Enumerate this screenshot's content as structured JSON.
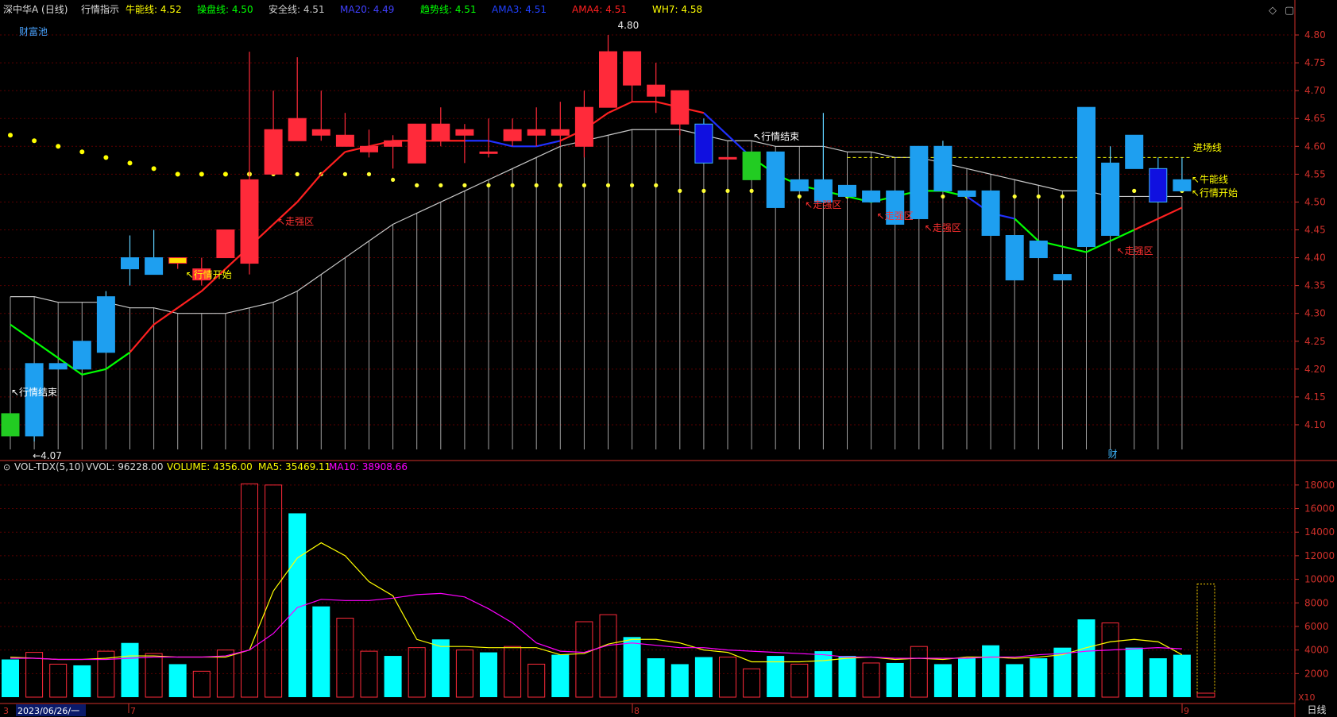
{
  "header": {
    "stock_label": "深中华A (日线)",
    "indicator_name": "行情指示",
    "params": [
      {
        "label": "牛能线:",
        "value": "4.52",
        "color": "#ffff00"
      },
      {
        "label": "操盘线:",
        "value": "4.50",
        "color": "#00ff00"
      },
      {
        "label": "安全线:",
        "value": "4.51",
        "color": "#c8c8c8"
      },
      {
        "label": "MA20:",
        "value": "4.49",
        "color": "#4040ff"
      },
      {
        "label": "趋势线:",
        "value": "4.51",
        "color": "#00ff00"
      },
      {
        "label": "AMA3:",
        "value": "4.51",
        "color": "#2040ff"
      },
      {
        "label": "AMA4:",
        "value": "4.51",
        "color": "#ff2020"
      },
      {
        "label": "WH7:",
        "value": "4.58",
        "color": "#ffff00"
      }
    ],
    "caifuchi": "财富池"
  },
  "volume_header": {
    "name": "VOL-TDX(5,10)",
    "vvol": "VVOL: 96228.00",
    "volume": "VOLUME: 4356.00",
    "ma5": "MA5: 35469.11",
    "ma10": "MA10: 38908.66"
  },
  "price_axis_ticks": [
    "4.80",
    "4.75",
    "4.70",
    "4.65",
    "4.60",
    "4.55",
    "4.50",
    "4.45",
    "4.40",
    "4.35",
    "4.30",
    "4.25",
    "4.20",
    "4.15",
    "4.10"
  ],
  "volume_axis_ticks": [
    "18000",
    "16000",
    "14000",
    "12000",
    "10000",
    "8000",
    "6000",
    "4000",
    "2000"
  ],
  "volume_unit": "X10",
  "date_axis": {
    "start": "2023/06/26/一",
    "marks": [
      "7",
      "8",
      "9"
    ],
    "first_mark": "3"
  },
  "period_tab": "日线",
  "annotations": {
    "high": "4.80",
    "low": "4.07",
    "market_end": "行情结束",
    "market_start": "行情开始",
    "strong_zone": "走强区",
    "entry_line": "进场线",
    "bull_line": "牛能线",
    "cai": "财"
  },
  "colors": {
    "up": "#ff2a3a",
    "down": "#1e9ff0",
    "cyan_vol": "#00ffff",
    "ma5_line": "#ffff00",
    "ma10_line": "#ff00ff",
    "safety_line": "#c8c8c8",
    "axis": "#d0302a",
    "grid": "#5a0000"
  },
  "chart_data": [
    {
      "type": "candlestick",
      "title": "深中华A (日线)",
      "ylim": [
        4.07,
        4.82
      ],
      "candles": [
        {
          "o": 4.08,
          "h": 4.12,
          "l": 4.08,
          "c": 4.12,
          "kind": "green"
        },
        {
          "o": 4.21,
          "h": 4.21,
          "l": 4.07,
          "c": 4.08,
          "kind": "down"
        },
        {
          "o": 4.21,
          "h": 4.21,
          "l": 4.2,
          "c": 4.2,
          "kind": "down"
        },
        {
          "o": 4.25,
          "h": 4.25,
          "l": 4.2,
          "c": 4.2,
          "kind": "down"
        },
        {
          "o": 4.33,
          "h": 4.34,
          "l": 4.23,
          "c": 4.23,
          "kind": "down"
        },
        {
          "o": 4.4,
          "h": 4.44,
          "l": 4.35,
          "c": 4.38,
          "kind": "down"
        },
        {
          "o": 4.4,
          "h": 4.45,
          "l": 4.37,
          "c": 4.37,
          "kind": "down"
        },
        {
          "o": 4.39,
          "h": 4.4,
          "l": 4.38,
          "c": 4.4,
          "kind": "yellow"
        },
        {
          "o": 4.36,
          "h": 4.4,
          "l": 4.35,
          "c": 4.38,
          "kind": "up"
        },
        {
          "o": 4.4,
          "h": 4.45,
          "l": 4.4,
          "c": 4.45,
          "kind": "up"
        },
        {
          "o": 4.39,
          "h": 4.77,
          "l": 4.37,
          "c": 4.54,
          "kind": "up"
        },
        {
          "o": 4.55,
          "h": 4.7,
          "l": 4.55,
          "c": 4.63,
          "kind": "up"
        },
        {
          "o": 4.61,
          "h": 4.76,
          "l": 4.61,
          "c": 4.65,
          "kind": "up"
        },
        {
          "o": 4.62,
          "h": 4.7,
          "l": 4.61,
          "c": 4.63,
          "kind": "up"
        },
        {
          "o": 4.6,
          "h": 4.66,
          "l": 4.6,
          "c": 4.62,
          "kind": "up"
        },
        {
          "o": 4.59,
          "h": 4.63,
          "l": 4.58,
          "c": 4.6,
          "kind": "up"
        },
        {
          "o": 4.6,
          "h": 4.62,
          "l": 4.56,
          "c": 4.61,
          "kind": "up"
        },
        {
          "o": 4.57,
          "h": 4.64,
          "l": 4.57,
          "c": 4.64,
          "kind": "up"
        },
        {
          "o": 4.61,
          "h": 4.67,
          "l": 4.6,
          "c": 4.64,
          "kind": "up"
        },
        {
          "o": 4.62,
          "h": 4.64,
          "l": 4.57,
          "c": 4.63,
          "kind": "up"
        },
        {
          "o": 4.59,
          "h": 4.65,
          "l": 4.58,
          "c": 4.59,
          "kind": "up"
        },
        {
          "o": 4.61,
          "h": 4.65,
          "l": 4.6,
          "c": 4.63,
          "kind": "up"
        },
        {
          "o": 4.62,
          "h": 4.67,
          "l": 4.6,
          "c": 4.63,
          "kind": "up"
        },
        {
          "o": 4.62,
          "h": 4.68,
          "l": 4.6,
          "c": 4.63,
          "kind": "up"
        },
        {
          "o": 4.6,
          "h": 4.7,
          "l": 4.58,
          "c": 4.67,
          "kind": "up"
        },
        {
          "o": 4.67,
          "h": 4.8,
          "l": 4.67,
          "c": 4.77,
          "kind": "up"
        },
        {
          "o": 4.71,
          "h": 4.77,
          "l": 4.68,
          "c": 4.77,
          "kind": "up"
        },
        {
          "o": 4.69,
          "h": 4.75,
          "l": 4.66,
          "c": 4.71,
          "kind": "up"
        },
        {
          "o": 4.64,
          "h": 4.7,
          "l": 4.62,
          "c": 4.7,
          "kind": "up"
        },
        {
          "o": 4.64,
          "h": 4.65,
          "l": 4.57,
          "c": 4.57,
          "kind": "blue"
        },
        {
          "o": 4.58,
          "h": 4.58,
          "l": 4.58,
          "c": 4.58,
          "kind": "up"
        },
        {
          "o": 4.54,
          "h": 4.59,
          "l": 4.54,
          "c": 4.59,
          "kind": "green"
        },
        {
          "o": 4.59,
          "h": 4.59,
          "l": 4.49,
          "c": 4.49,
          "kind": "down"
        },
        {
          "o": 4.54,
          "h": 4.54,
          "l": 4.52,
          "c": 4.52,
          "kind": "down"
        },
        {
          "o": 4.54,
          "h": 4.66,
          "l": 4.5,
          "c": 4.5,
          "kind": "down"
        },
        {
          "o": 4.53,
          "h": 4.53,
          "l": 4.51,
          "c": 4.51,
          "kind": "down"
        },
        {
          "o": 4.52,
          "h": 4.52,
          "l": 4.5,
          "c": 4.5,
          "kind": "down"
        },
        {
          "o": 4.52,
          "h": 4.52,
          "l": 4.46,
          "c": 4.46,
          "kind": "down"
        },
        {
          "o": 4.6,
          "h": 4.6,
          "l": 4.47,
          "c": 4.47,
          "kind": "down"
        },
        {
          "o": 4.6,
          "h": 4.61,
          "l": 4.52,
          "c": 4.52,
          "kind": "down"
        },
        {
          "o": 4.52,
          "h": 4.52,
          "l": 4.51,
          "c": 4.51,
          "kind": "down"
        },
        {
          "o": 4.52,
          "h": 4.52,
          "l": 4.44,
          "c": 4.44,
          "kind": "down"
        },
        {
          "o": 4.44,
          "h": 4.44,
          "l": 4.36,
          "c": 4.36,
          "kind": "down"
        },
        {
          "o": 4.43,
          "h": 4.43,
          "l": 4.4,
          "c": 4.4,
          "kind": "down"
        },
        {
          "o": 4.37,
          "h": 4.37,
          "l": 4.36,
          "c": 4.36,
          "kind": "down"
        },
        {
          "o": 4.67,
          "h": 4.67,
          "l": 4.42,
          "c": 4.42,
          "kind": "down"
        },
        {
          "o": 4.57,
          "h": 4.6,
          "l": 4.44,
          "c": 4.44,
          "kind": "down"
        },
        {
          "o": 4.62,
          "h": 4.62,
          "l": 4.56,
          "c": 4.56,
          "kind": "down"
        },
        {
          "o": 4.56,
          "h": 4.58,
          "l": 4.5,
          "c": 4.5,
          "kind": "blue"
        },
        {
          "o": 4.54,
          "h": 4.58,
          "l": 4.52,
          "c": 4.52,
          "kind": "down"
        }
      ],
      "bull_line": [
        null,
        null,
        null,
        null,
        null,
        null,
        null,
        null,
        null,
        null,
        4.55,
        4.55,
        4.55,
        4.55,
        4.55,
        4.55,
        4.54,
        4.53,
        4.53,
        4.53,
        4.53,
        4.53,
        4.53,
        4.53,
        4.53,
        4.53,
        4.53,
        4.53,
        4.52,
        4.52,
        4.52,
        4.52,
        4.52,
        4.51,
        4.51,
        4.51,
        4.51,
        4.51,
        4.51,
        4.51,
        4.51,
        4.51,
        4.51,
        4.51,
        4.51,
        4.51,
        4.51,
        4.52,
        4.52,
        4.52
      ],
      "upper_dots": [
        4.62,
        4.61,
        4.6,
        4.59,
        4.58,
        4.57,
        4.56,
        4.55,
        4.55,
        4.55,
        4.55
      ],
      "trend_line": [
        4.28,
        4.25,
        4.22,
        4.19,
        4.2,
        4.23,
        4.28,
        4.31,
        4.34,
        4.38,
        4.42,
        4.46,
        4.5,
        4.55,
        4.59,
        4.6,
        4.61,
        4.61,
        4.61,
        4.61,
        4.61,
        4.6,
        4.6,
        4.61,
        4.63,
        4.66,
        4.68,
        4.68,
        4.67,
        4.66,
        4.62,
        4.58,
        4.55,
        4.53,
        4.52,
        4.51,
        4.5,
        4.51,
        4.52,
        4.52,
        4.51,
        4.48,
        4.47,
        4.43,
        4.42,
        4.41,
        4.43,
        4.45,
        4.47,
        4.49,
        4.52
      ],
      "safety_line": [
        4.33,
        4.33,
        4.32,
        4.32,
        4.32,
        4.31,
        4.31,
        4.3,
        4.3,
        4.3,
        4.31,
        4.32,
        4.34,
        4.37,
        4.4,
        4.43,
        4.46,
        4.48,
        4.5,
        4.52,
        4.54,
        4.56,
        4.58,
        4.6,
        4.61,
        4.62,
        4.63,
        4.63,
        4.63,
        4.62,
        4.61,
        4.61,
        4.6,
        4.6,
        4.6,
        4.59,
        4.59,
        4.58,
        4.58,
        4.57,
        4.56,
        4.55,
        4.54,
        4.53,
        4.52,
        4.52,
        4.51,
        4.51,
        4.51,
        4.51
      ],
      "entry_line": 4.58
    },
    {
      "type": "bar",
      "title": "VOL-TDX(5,10)",
      "ylabel": "X10",
      "ylim": [
        0,
        19000
      ],
      "values": [
        3200,
        3800,
        2800,
        2700,
        3900,
        4600,
        3700,
        2800,
        2200,
        4000,
        18100,
        18000,
        15600,
        7700,
        6700,
        3900,
        3500,
        4200,
        4900,
        4000,
        3800,
        4300,
        2800,
        3600,
        6400,
        7000,
        5100,
        3300,
        2800,
        3400,
        3400,
        2400,
        3500,
        2800,
        3900,
        3500,
        2900,
        2900,
        4300,
        2800,
        3300,
        4400,
        2800,
        3300,
        4200,
        6600,
        6300,
        4200,
        3300,
        3600,
        9600
      ],
      "kinds": [
        "cyan",
        "up",
        "up",
        "cyan",
        "up",
        "cyan",
        "up",
        "cyan",
        "up",
        "up",
        "up",
        "up",
        "cyan",
        "cyan",
        "up",
        "up",
        "cyan",
        "up",
        "cyan",
        "up",
        "cyan",
        "up",
        "up",
        "cyan",
        "up",
        "up",
        "cyan",
        "cyan",
        "cyan",
        "cyan",
        "up",
        "up",
        "cyan",
        "up",
        "cyan",
        "cyan",
        "up",
        "cyan",
        "up",
        "cyan",
        "cyan",
        "cyan",
        "cyan",
        "cyan",
        "cyan",
        "cyan",
        "up",
        "cyan",
        "cyan",
        "cyan",
        "yellow"
      ],
      "series": [
        {
          "name": "MA5",
          "values": [
            3400,
            3300,
            3200,
            3200,
            3300,
            3500,
            3500,
            3400,
            3400,
            3400,
            4000,
            9000,
            11800,
            13100,
            12000,
            9800,
            8600,
            4900,
            4300,
            4300,
            4200,
            4200,
            4200,
            3600,
            3700,
            4500,
            4900,
            4900,
            4600,
            4000,
            3800,
            3000,
            3000,
            3000,
            3100,
            3300,
            3400,
            3200,
            3300,
            3200,
            3400,
            3400,
            3300,
            3400,
            3600,
            4200,
            4700,
            4900,
            4700,
            3600
          ]
        },
        {
          "name": "MA10",
          "values": [
            3300,
            3300,
            3200,
            3200,
            3200,
            3300,
            3400,
            3400,
            3400,
            3500,
            4000,
            5400,
            7600,
            8300,
            8200,
            8200,
            8400,
            8700,
            8800,
            8500,
            7500,
            6300,
            4600,
            3900,
            3800,
            4400,
            4600,
            4400,
            4200,
            4200,
            4000,
            3900,
            3800,
            3700,
            3600,
            3400,
            3400,
            3300,
            3300,
            3300,
            3300,
            3400,
            3400,
            3600,
            3700,
            3900,
            4000,
            4100,
            4200,
            4100
          ]
        }
      ]
    }
  ]
}
